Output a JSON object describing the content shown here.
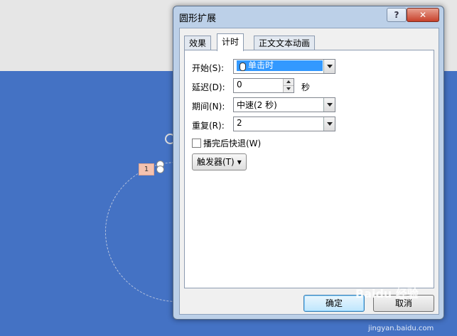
{
  "dialog": {
    "title": "圆形扩展",
    "help_label": "?",
    "close_label": "✕",
    "tabs": [
      {
        "label": "效果"
      },
      {
        "label": "计时"
      },
      {
        "label": "正文文本动画"
      }
    ],
    "active_tab": "计时",
    "fields": {
      "start": {
        "label": "开始(S):",
        "value": "单击时"
      },
      "delay": {
        "label": "延迟(D):",
        "value": "0",
        "unit": "秒"
      },
      "duration": {
        "label": "期间(N):",
        "value": "中速(2 秒)"
      },
      "repeat": {
        "label": "重复(R):",
        "value": "2"
      },
      "rewind": {
        "label": "播完后快退(W)",
        "checked": false
      }
    },
    "trigger_label": "触发器(T)",
    "trigger_caret": "▾",
    "ok_label": "确定",
    "cancel_label": "取消"
  },
  "canvas": {
    "animation_tag": "1"
  },
  "watermark": {
    "text": "Baidu 经验",
    "url": "jingyan.baidu.com"
  },
  "colors": {
    "slide_bg": "#4472c4",
    "selection": "#3399ff"
  }
}
